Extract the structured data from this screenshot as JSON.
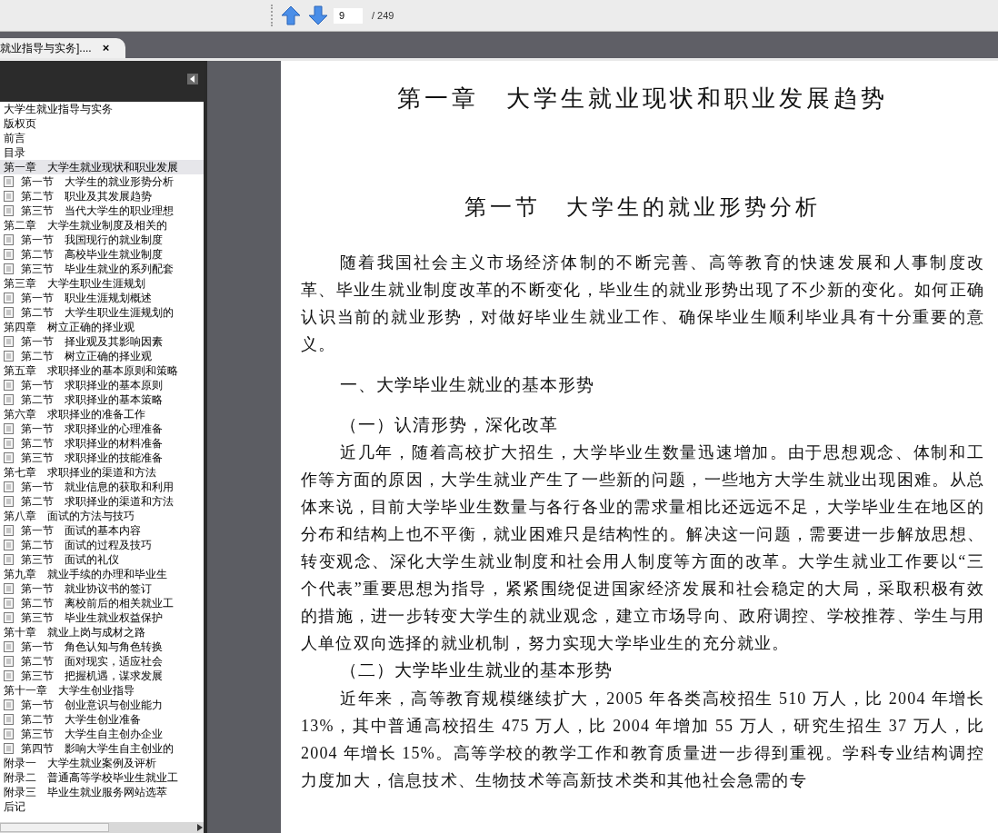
{
  "toolbar": {
    "page_field": {
      "value": "9"
    },
    "page_total": "/ 249"
  },
  "tabs": [
    {
      "label": "就业指导与实务]....",
      "close": "×",
      "selected": true
    }
  ],
  "bookmarks": [
    {
      "label": "大学生就业指导与实务",
      "selected": false
    },
    {
      "label": "版权页",
      "selected": false
    },
    {
      "label": "前言",
      "selected": false
    },
    {
      "label": "目录",
      "selected": false
    },
    {
      "label": "第一章　大学生就业现状和职业发展",
      "selected": true,
      "children": [
        {
          "label": "第一节　大学生的就业形势分析",
          "selected": false
        },
        {
          "label": "第二节　职业及其发展趋势",
          "selected": false
        },
        {
          "label": "第三节　当代大学生的职业理想",
          "selected": false
        }
      ]
    },
    {
      "label": "第二章　大学生就业制度及相关的",
      "selected": false,
      "children": [
        {
          "label": "第一节　我国现行的就业制度",
          "selected": false
        },
        {
          "label": "第二节　高校毕业生就业制度",
          "selected": false
        },
        {
          "label": "第三节　毕业生就业的系列配套",
          "selected": false
        }
      ]
    },
    {
      "label": "第三章　大学生职业生涯规划",
      "selected": false,
      "children": [
        {
          "label": "第一节　职业生涯规划概述",
          "selected": false
        },
        {
          "label": "第二节　大学生职业生涯规划的",
          "selected": false
        }
      ]
    },
    {
      "label": "第四章　树立正确的择业观",
      "selected": false,
      "children": [
        {
          "label": "第一节　择业观及其影响因素",
          "selected": false
        },
        {
          "label": "第二节　树立正确的择业观",
          "selected": false
        }
      ]
    },
    {
      "label": "第五章　求职择业的基本原则和策略",
      "selected": false,
      "children": [
        {
          "label": "第一节　求职择业的基本原则",
          "selected": false
        },
        {
          "label": "第二节　求职择业的基本策略",
          "selected": false
        }
      ]
    },
    {
      "label": "第六章　求职择业的准备工作",
      "selected": false,
      "children": [
        {
          "label": "第一节　求职择业的心理准备",
          "selected": false
        },
        {
          "label": "第二节　求职择业的材料准备",
          "selected": false
        },
        {
          "label": "第三节　求职择业的技能准备",
          "selected": false
        }
      ]
    },
    {
      "label": "第七章　求职择业的渠道和方法",
      "selected": false,
      "children": [
        {
          "label": "第一节　就业信息的获取和利用",
          "selected": false
        },
        {
          "label": "第二节　求职择业的渠道和方法",
          "selected": false
        }
      ]
    },
    {
      "label": "第八章　面试的方法与技巧",
      "selected": false,
      "children": [
        {
          "label": "第一节　面试的基本内容",
          "selected": false
        },
        {
          "label": "第二节　面试的过程及技巧",
          "selected": false
        },
        {
          "label": "第三节　面试的礼仪",
          "selected": false
        }
      ]
    },
    {
      "label": "第九章　就业手续的办理和毕业生",
      "selected": false,
      "children": [
        {
          "label": "第一节　就业协议书的签订",
          "selected": false
        },
        {
          "label": "第二节　离校前后的相关就业工",
          "selected": false
        },
        {
          "label": "第三节　毕业生就业权益保护",
          "selected": false
        }
      ]
    },
    {
      "label": "第十章　就业上岗与成材之路",
      "selected": false,
      "children": [
        {
          "label": "第一节　角色认知与角色转换",
          "selected": false
        },
        {
          "label": "第二节　面对现实，适应社会",
          "selected": false
        },
        {
          "label": "第三节　把握机遇，谋求发展",
          "selected": false
        }
      ]
    },
    {
      "label": "第十一章　大学生创业指导",
      "selected": false,
      "children": [
        {
          "label": "第一节　创业意识与创业能力",
          "selected": false
        },
        {
          "label": "第二节　大学生创业准备",
          "selected": false
        },
        {
          "label": "第三节　大学生自主创办企业",
          "selected": false
        },
        {
          "label": "第四节　影响大学生自主创业的",
          "selected": false
        }
      ]
    },
    {
      "label": "附录一　大学生就业案例及评析",
      "selected": false
    },
    {
      "label": "附录二　普通高等学校毕业生就业工",
      "selected": false
    },
    {
      "label": "附录三　毕业生就业服务网站选萃",
      "selected": false
    },
    {
      "label": "后记",
      "selected": false
    }
  ],
  "page": {
    "chapter_title": "第一章　大学生就业现状和职业发展趋势",
    "section_title": "第一节　大学生的就业形势分析",
    "blocks": [
      {
        "kind": "paragraph",
        "text": "随着我国社会主义市场经济体制的不断完善、高等教育的快速发展和人事制度改革、毕业生就业制度改革的不断变化，毕业生的就业形势出现了不少新的变化。如何正确认识当前的就业形势，对做好毕业生就业工作、确保毕业生顺利毕业具有十分重要的意义。"
      },
      {
        "kind": "heading",
        "text": "一、大学毕业生就业的基本形势"
      },
      {
        "kind": "subheading",
        "text": "（一）认清形势，深化改革"
      },
      {
        "kind": "paragraph",
        "text": "近几年，随着高校扩大招生，大学毕业生数量迅速增加。由于思想观念、体制和工作等方面的原因，大学生就业产生了一些新的问题，一些地方大学生就业出现困难。从总体来说，目前大学毕业生数量与各行各业的需求量相比还远远不足，大学毕业生在地区的分布和结构上也不平衡，就业困难只是结构性的。解决这一问题，需要进一步解放思想、转变观念、深化大学生就业制度和社会用人制度等方面的改革。大学生就业工作要以“三个代表”重要思想为指导，紧紧围绕促进国家经济发展和社会稳定的大局，采取积极有效的措施，进一步转变大学生的就业观念，建立市场导向、政府调控、学校推荐、学生与用人单位双向选择的就业机制，努力实现大学毕业生的充分就业。"
      },
      {
        "kind": "subheading",
        "text": "（二）大学毕业生就业的基本形势"
      },
      {
        "kind": "paragraph",
        "text": "近年来，高等教育规模继续扩大，2005 年各类高校招生 510 万人，比 2004 年增长 13%，其中普通高校招生 475 万人，比 2004 年增加 55 万人，研究生招生 37 万人，比 2004 年增长 15%。高等学校的教学工作和教育质量进一步得到重视。学科专业结构调控力度加大，信息技术、生物技术等高新技术类和其他社会急需的专"
      }
    ]
  }
}
